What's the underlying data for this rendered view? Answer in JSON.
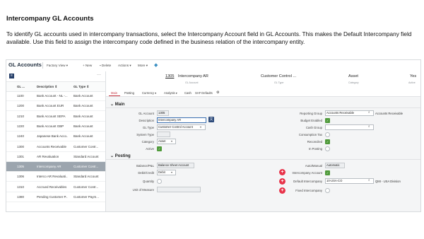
{
  "doc": {
    "title": "Intercompany GL Accounts",
    "paragraph": "To identify GL accounts used in intercompany transactions, select the Intercompany Account field in GL Accounts. This makes the Default Intercompany field available. Use this field to assign the intercompany code defined in the business relation of the intercompany entity."
  },
  "app": {
    "title": "GL Accounts",
    "toolbar": {
      "factory_view": "Factory View",
      "new": "New",
      "delete": "Delete",
      "actions": "Actions",
      "more": "More"
    }
  },
  "list": {
    "headers": [
      "GL ...",
      "Description",
      "GL Type"
    ],
    "rows": [
      [
        "1100",
        "Bank Account - NL -...",
        "Bank Account"
      ],
      [
        "1200",
        "Bank Account EUR",
        "Bank Account"
      ],
      [
        "1210",
        "Bank Account SEPA",
        "Bank Account"
      ],
      [
        "1220",
        "Bank Account GBP",
        "Bank Account"
      ],
      [
        "1240",
        "Japanese Bank Acco...",
        "Bank Account"
      ],
      [
        "1300",
        "Accounts Receivable",
        "Customer Contr..."
      ],
      [
        "1301",
        "AR Revaluation",
        "Standard Account"
      ],
      [
        "1305",
        "Intercompany AR",
        "Customer Contr..."
      ],
      [
        "1306",
        "Interco AR Revaluati...",
        "Standard Account"
      ],
      [
        "1310",
        "Accrued Receivables",
        "Customer Contr..."
      ],
      [
        "1380",
        "Pending Customer P...",
        "Customer Paym..."
      ]
    ],
    "selected_index": 7
  },
  "record": {
    "number": "1305",
    "name": "Intercompany AR",
    "name_caption": "GL Account",
    "type": "Customer Control ...",
    "type_caption": "GL Type",
    "category": "Asset",
    "category_caption": "Category",
    "active": "Yes",
    "active_caption": "Active"
  },
  "tabs": [
    "Main",
    "Posting",
    "Currency",
    "Analysis",
    "Cash",
    "SAF Defaults"
  ],
  "main": {
    "section": "Main",
    "gl_account_label": "GL Account",
    "gl_account_value": "1305",
    "description_label": "Description",
    "description_value": "Intercompany AR",
    "gl_type_label": "GL Type",
    "gl_type_value": "Customer Control Account",
    "system_type_label": "System Type",
    "category_label": "Category",
    "category_value": "Asset",
    "active_label": "Active",
    "reporting_group_label": "Reporting Group",
    "reporting_group_value": "Accounts Receivable",
    "reporting_group_desc": "Accounts Receivable",
    "budget_enabled_label": "Budget Enabled",
    "cash_group_label": "Cash Group",
    "consumption_tax_label": "Consumption Tax",
    "reconciled_label": "Reconciled",
    "in_posting_label": "In Posting"
  },
  "posting": {
    "section": "Posting",
    "balance_pl_label": "Balance/P&L",
    "balance_pl_value": "Balance Sheet Account",
    "debit_credit_label": "Debit/Credit",
    "debit_credit_value": "Debit",
    "quantity_label": "Quantity",
    "unit_label": "Unit of Measure",
    "auto_manual_label": "Auto/Manual",
    "auto_manual_value": "Automatic",
    "interco_account_label": "Intercompany Account",
    "default_interco_label": "Default Intercompany",
    "default_interco_value": "10-USA-CO",
    "default_interco_desc": "QMI - USA Division",
    "fixed_interco_label": "Fixed Intercompany"
  },
  "colors": {
    "accent": "#c4303d",
    "check": "#4f9a3a",
    "plus": "#e8334a",
    "selected_row": "#9ca5ae"
  }
}
